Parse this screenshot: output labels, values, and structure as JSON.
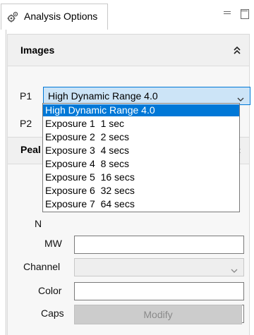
{
  "tab": {
    "title": "Analysis Options",
    "icon": "gears-icon"
  },
  "window_controls": {
    "minimize_icon": "minimize-icon",
    "maximize_icon": "maximize-icon"
  },
  "images_section": {
    "title": "Images",
    "collapse_icon": "double-chevron-up-icon",
    "p1_label": "P1",
    "p2_label": "P2",
    "p1_value": "High Dynamic Range 4.0",
    "dropdown_options": [
      "High Dynamic Range 4.0",
      "Exposure 1  1 sec",
      "Exposure 2  2 secs",
      "Exposure 3  4 secs",
      "Exposure 4  8 secs",
      "Exposure 5  16 secs",
      "Exposure 6  32 secs",
      "Exposure 7  64 secs"
    ],
    "selected_option": "High Dynamic Range 4.0"
  },
  "peaks_section": {
    "title": "Peal",
    "collapse_icon": "double-chevron-up-icon",
    "name_label": "N",
    "mw_label": "MW",
    "channel_label": "Channel",
    "color_label": "Color",
    "caps_label": "Caps",
    "modify_button": "Modify"
  },
  "colors": {
    "accent": "#0078d7",
    "selected_field_bg": "#cce4f7",
    "disabled_button": "#cccccc"
  }
}
